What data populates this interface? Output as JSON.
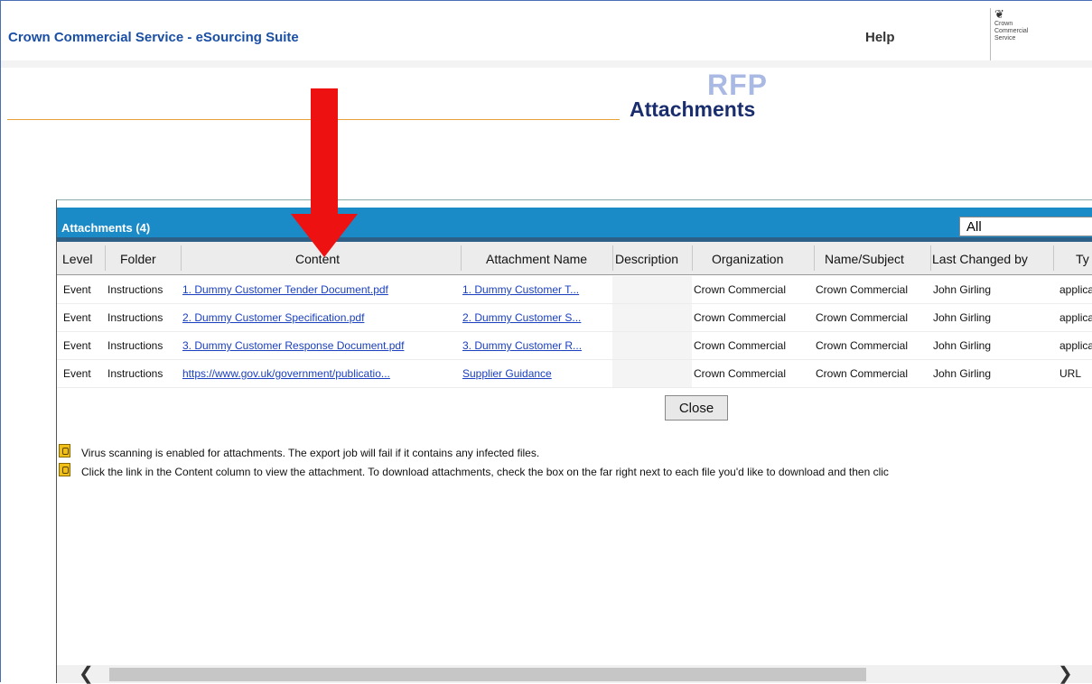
{
  "app": {
    "title": "Crown Commercial Service - eSourcing Suite",
    "help_label": "Help",
    "logo_crest": "❦",
    "logo_lines": [
      "Crown",
      "Commercial",
      "Service"
    ]
  },
  "page": {
    "watermark": "RFP",
    "heading": "Attachments"
  },
  "dialog": {
    "title": "Attachments (4)",
    "filter_value": "All",
    "columns": [
      "Level",
      "Folder",
      "Content",
      "Attachment Name",
      "Description",
      "Organization",
      "Name/Subject",
      "Last Changed by",
      "Ty"
    ],
    "rows": [
      {
        "level": "Event",
        "folder": "Instructions",
        "content": "1. Dummy Customer Tender Document.pdf",
        "attachment_name": "1. Dummy Customer T...",
        "description": "",
        "organization": "Crown Commercial",
        "name_subject": "Crown Commercial",
        "last_changed_by": "John Girling",
        "type": "applica"
      },
      {
        "level": "Event",
        "folder": "Instructions",
        "content": "2. Dummy Customer Specification.pdf",
        "attachment_name": "2. Dummy Customer S...",
        "description": "",
        "organization": "Crown Commercial",
        "name_subject": "Crown Commercial",
        "last_changed_by": "John Girling",
        "type": "applica"
      },
      {
        "level": "Event",
        "folder": "Instructions",
        "content": "3. Dummy Customer Response Document.pdf",
        "attachment_name": "3. Dummy Customer R...",
        "description": "",
        "organization": "Crown Commercial",
        "name_subject": "Crown Commercial",
        "last_changed_by": "John Girling",
        "type": "applica"
      },
      {
        "level": "Event",
        "folder": "Instructions",
        "content": "https://www.gov.uk/government/publicatio...",
        "attachment_name": "Supplier Guidance",
        "description": "",
        "organization": "Crown Commercial",
        "name_subject": "Crown Commercial",
        "last_changed_by": "John Girling",
        "type": "URL"
      }
    ],
    "close_label": "Close",
    "notes": [
      "Virus scanning is enabled for attachments. The export job will fail if it contains any infected files.",
      "Click the link in the Content column to view the attachment. To download attachments, check the box on the far right next to each file you'd like to download and then clic"
    ],
    "scroll_left": "❮",
    "scroll_right": "❯"
  },
  "colors": {
    "dialog_header": "#1a8bc6",
    "annotation_arrow": "#ee1111",
    "link": "#1a3fbf",
    "title_blue": "#1b4fa3"
  }
}
